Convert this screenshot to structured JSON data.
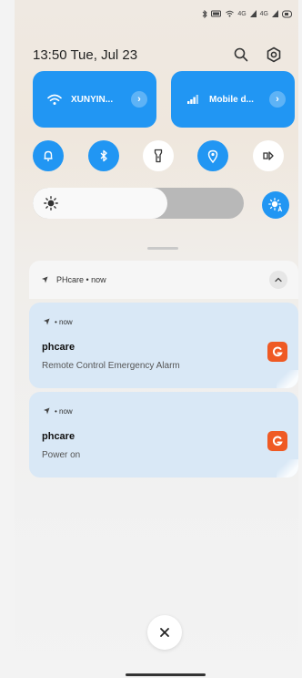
{
  "status_bar": {
    "icons": [
      "bluetooth-icon",
      "battery-saver-icon",
      "wifi-icon",
      "signal-1-icon",
      "signal-2-icon",
      "battery-icon"
    ],
    "signal_1_label": "4G",
    "signal_2_label": "4G"
  },
  "header": {
    "time": "13:50",
    "date": "Tue, Jul 23",
    "icons": [
      "search-icon",
      "settings-icon"
    ]
  },
  "quick_tiles": [
    {
      "id": "wifi",
      "label": "XUNYIN...",
      "icon": "wifi-icon",
      "active": true
    },
    {
      "id": "mobile-data",
      "label": "Mobile d...",
      "icon": "signal-bars-icon",
      "active": true
    }
  ],
  "toggles": [
    {
      "id": "sound",
      "icon": "bell-icon",
      "active": true
    },
    {
      "id": "bluetooth",
      "icon": "bluetooth-icon",
      "active": true
    },
    {
      "id": "flashlight",
      "icon": "flashlight-icon",
      "active": false
    },
    {
      "id": "location",
      "icon": "location-pin-icon",
      "active": true
    },
    {
      "id": "cast",
      "icon": "cast-arrow-icon",
      "active": false
    }
  ],
  "brightness": {
    "level": 0.64,
    "auto": true
  },
  "colors": {
    "accent": "#2196f3",
    "notif_bg": "#d9e8f6",
    "app_icon": "#ef5a24"
  },
  "notification_group": {
    "header_label": "PHcare • now",
    "notifications": [
      {
        "meta": "• now",
        "title": "phcare",
        "text": "Remote Control Emergency Alarm"
      },
      {
        "meta": "• now",
        "title": "phcare",
        "text": "Power on"
      }
    ]
  }
}
